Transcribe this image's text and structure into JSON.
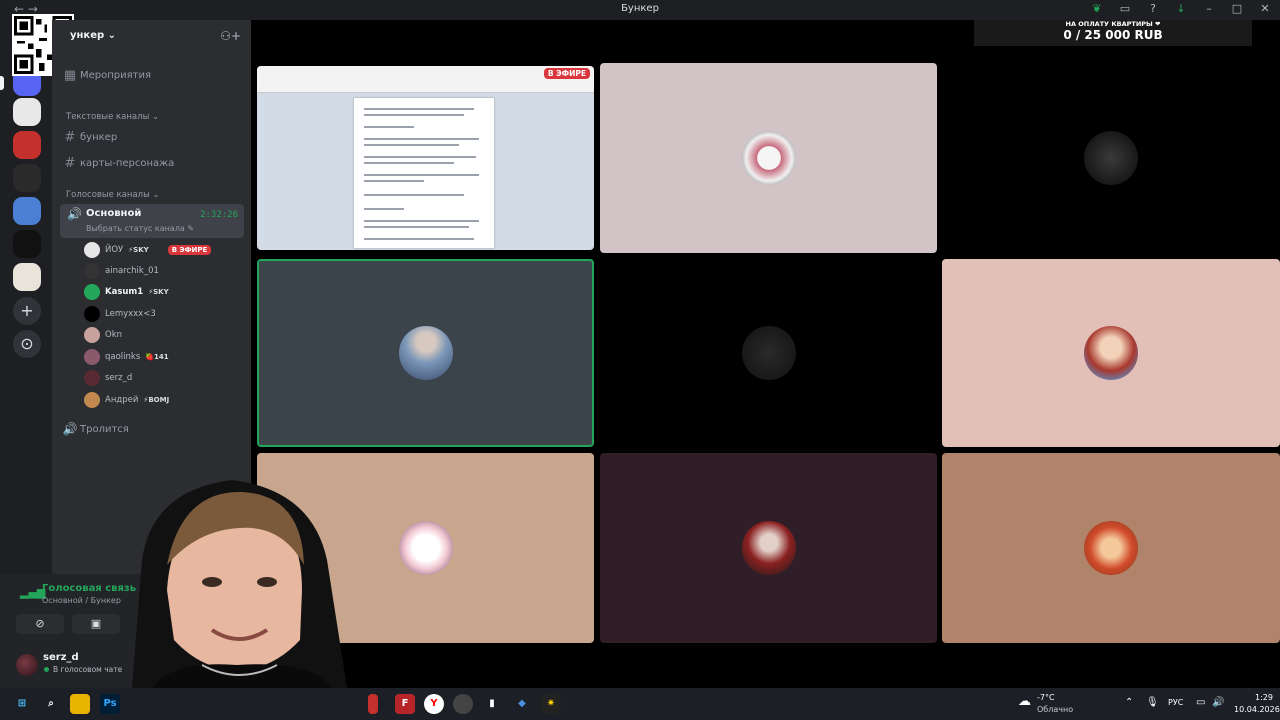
{
  "window": {
    "title": "Бункер"
  },
  "server": {
    "name": "ункер",
    "events_label": "Мероприятия",
    "text_category": "Текстовые каналы",
    "text_channels": [
      "бункер",
      "карты-персонажа"
    ],
    "voice_category": "Голосовые каналы",
    "voice_channel": {
      "name": "Основной",
      "timer": "2:32:26",
      "status_placeholder": "Выбрать статус канала"
    },
    "members": [
      {
        "name": "ЙОУ",
        "tag": "⚡SKY",
        "live": "В ЭФИРЕ"
      },
      {
        "name": "ainarchik_01",
        "tag": ""
      },
      {
        "name": "Kasum1",
        "tag": "⚡SKY"
      },
      {
        "name": "Lemyxxx<3",
        "tag": ""
      },
      {
        "name": "Okn",
        "tag": ""
      },
      {
        "name": "qaolinks",
        "tag": "🍓141"
      },
      {
        "name": "serz_d",
        "tag": ""
      },
      {
        "name": "Андрей",
        "tag": "⚡BOMJ"
      }
    ],
    "second_voice_channel": "Тролится"
  },
  "voice_panel": {
    "state": "Голосовая связь п",
    "path": "Основной / Бункер"
  },
  "user": {
    "name": "serz_d",
    "status": "В голосовом чате"
  },
  "stage": {
    "live_badge": "В ЭФИРЕ",
    "donation_label": "НА ОПЛАТУ КВАРТИРЫ ❤",
    "donation_amount": "0 / 25 000 RUB"
  },
  "taskbar": {
    "weather_temp": "-7°C",
    "weather_desc": "Облачно",
    "lang": "РУС",
    "time": "1:29",
    "date": "10.04.2026"
  },
  "colors": {
    "accent_green": "#23a55a",
    "live_red": "#da373c",
    "sidebar": "#2b2d31"
  }
}
